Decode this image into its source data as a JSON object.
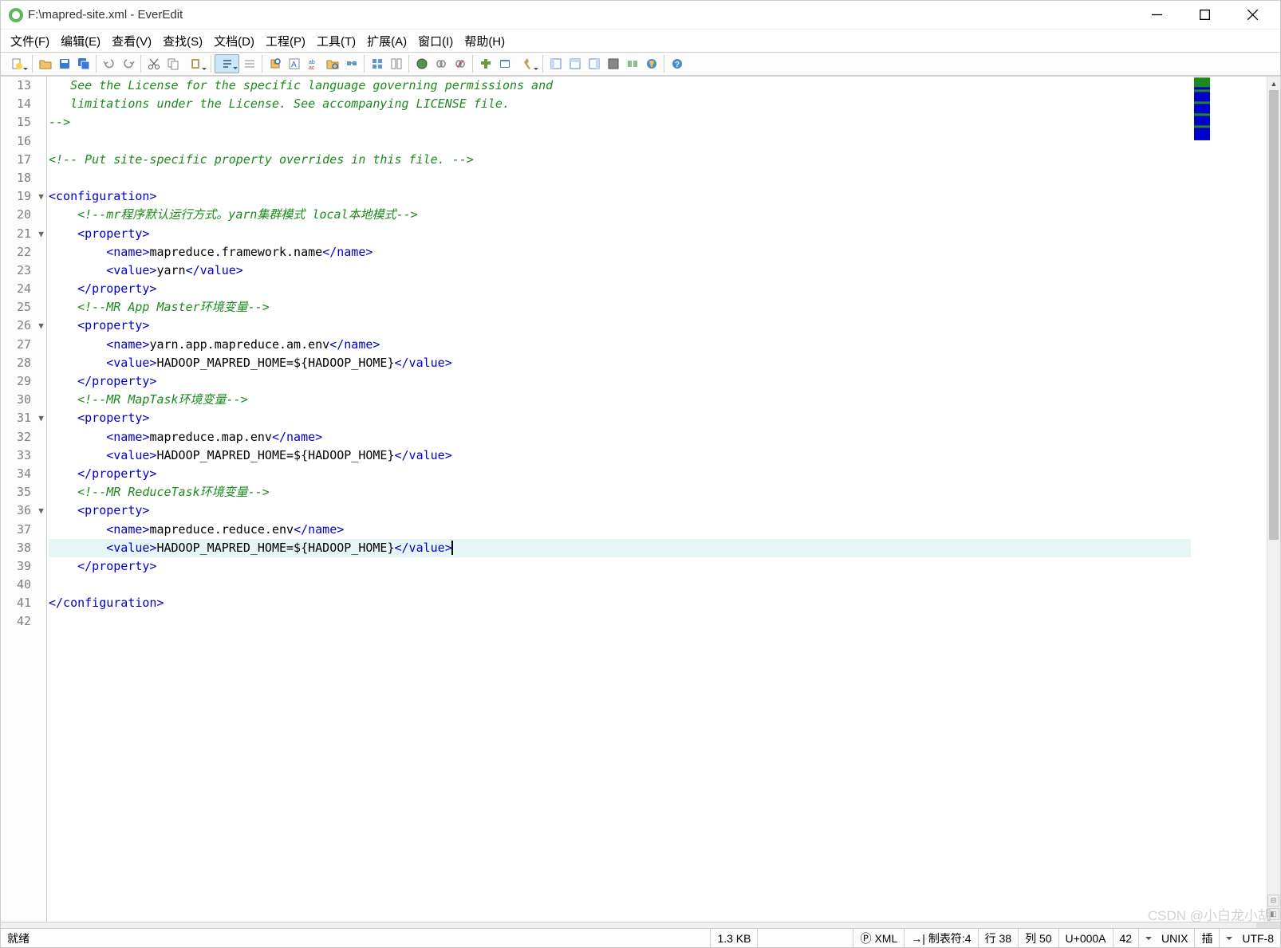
{
  "title": "F:\\mapred-site.xml - EverEdit",
  "menu": [
    "文件(F)",
    "编辑(E)",
    "查看(V)",
    "查找(S)",
    "文档(D)",
    "工程(P)",
    "工具(T)",
    "扩展(A)",
    "窗口(I)",
    "帮助(H)"
  ],
  "lines_start": 13,
  "lines_end": 42,
  "fold_markers": {
    "19": "▼",
    "21": "▼",
    "26": "▼",
    "31": "▼",
    "36": "▼"
  },
  "highlighted_line": 38,
  "code": {
    "13": [
      {
        "t": "comment",
        "v": "   See the License for the specific language governing permissions and"
      }
    ],
    "14": [
      {
        "t": "comment",
        "v": "   limitations under the License. See accompanying LICENSE file."
      }
    ],
    "15": [
      {
        "t": "comment",
        "v": "-->"
      }
    ],
    "16": [],
    "17": [
      {
        "t": "comment",
        "v": "<!-- Put site-specific property overrides in this file. -->"
      }
    ],
    "18": [],
    "19": [
      {
        "t": "tag",
        "v": "<configuration>"
      }
    ],
    "20": [
      {
        "t": "plain",
        "v": "    "
      },
      {
        "t": "comment",
        "v": "<!--mr程序默认运行方式。yarn集群模式 local本地模式-->"
      }
    ],
    "21": [
      {
        "t": "plain",
        "v": "    "
      },
      {
        "t": "tag",
        "v": "<property>"
      }
    ],
    "22": [
      {
        "t": "plain",
        "v": "        "
      },
      {
        "t": "tag",
        "v": "<name>"
      },
      {
        "t": "text",
        "v": "mapreduce.framework.name"
      },
      {
        "t": "tag",
        "v": "</name>"
      }
    ],
    "23": [
      {
        "t": "plain",
        "v": "        "
      },
      {
        "t": "tag",
        "v": "<value>"
      },
      {
        "t": "text",
        "v": "yarn"
      },
      {
        "t": "tag",
        "v": "</value>"
      }
    ],
    "24": [
      {
        "t": "plain",
        "v": "    "
      },
      {
        "t": "tag",
        "v": "</property>"
      }
    ],
    "25": [
      {
        "t": "plain",
        "v": "    "
      },
      {
        "t": "comment",
        "v": "<!--MR App Master环境变量-->"
      }
    ],
    "26": [
      {
        "t": "plain",
        "v": "    "
      },
      {
        "t": "tag",
        "v": "<property>"
      }
    ],
    "27": [
      {
        "t": "plain",
        "v": "        "
      },
      {
        "t": "tag",
        "v": "<name>"
      },
      {
        "t": "text",
        "v": "yarn.app.mapreduce.am.env"
      },
      {
        "t": "tag",
        "v": "</name>"
      }
    ],
    "28": [
      {
        "t": "plain",
        "v": "        "
      },
      {
        "t": "tag",
        "v": "<value>"
      },
      {
        "t": "text",
        "v": "HADOOP_MAPRED_HOME=${HADOOP_HOME}"
      },
      {
        "t": "tag",
        "v": "</value>"
      }
    ],
    "29": [
      {
        "t": "plain",
        "v": "    "
      },
      {
        "t": "tag",
        "v": "</property>"
      }
    ],
    "30": [
      {
        "t": "plain",
        "v": "    "
      },
      {
        "t": "comment",
        "v": "<!--MR MapTask环境变量-->"
      }
    ],
    "31": [
      {
        "t": "plain",
        "v": "    "
      },
      {
        "t": "tag",
        "v": "<property>"
      }
    ],
    "32": [
      {
        "t": "plain",
        "v": "        "
      },
      {
        "t": "tag",
        "v": "<name>"
      },
      {
        "t": "text",
        "v": "mapreduce.map.env"
      },
      {
        "t": "tag",
        "v": "</name>"
      }
    ],
    "33": [
      {
        "t": "plain",
        "v": "        "
      },
      {
        "t": "tag",
        "v": "<value>"
      },
      {
        "t": "text",
        "v": "HADOOP_MAPRED_HOME=${HADOOP_HOME}"
      },
      {
        "t": "tag",
        "v": "</value>"
      }
    ],
    "34": [
      {
        "t": "plain",
        "v": "    "
      },
      {
        "t": "tag",
        "v": "</property>"
      }
    ],
    "35": [
      {
        "t": "plain",
        "v": "    "
      },
      {
        "t": "comment",
        "v": "<!--MR ReduceTask环境变量-->"
      }
    ],
    "36": [
      {
        "t": "plain",
        "v": "    "
      },
      {
        "t": "tag",
        "v": "<property>"
      }
    ],
    "37": [
      {
        "t": "plain",
        "v": "        "
      },
      {
        "t": "tag",
        "v": "<name>"
      },
      {
        "t": "text",
        "v": "mapreduce.reduce.env"
      },
      {
        "t": "tag",
        "v": "</name>"
      }
    ],
    "38": [
      {
        "t": "plain",
        "v": "        "
      },
      {
        "t": "tag",
        "v": "<value>"
      },
      {
        "t": "text",
        "v": "HADOOP_MAPRED_HOME=${HADOOP_HOME}"
      },
      {
        "t": "tag",
        "v": "</value>"
      },
      {
        "t": "caret",
        "v": ""
      }
    ],
    "39": [
      {
        "t": "plain",
        "v": "    "
      },
      {
        "t": "tag",
        "v": "</property>"
      }
    ],
    "40": [],
    "41": [
      {
        "t": "tag",
        "v": "</configuration>"
      }
    ],
    "42": []
  },
  "status": {
    "ready": "就绪",
    "size": "1.3 KB",
    "lang_icon": "Ⓟ",
    "lang": "XML",
    "tab_icon": "→|",
    "tab": "制表符:4",
    "line": "行 38",
    "col": "列 50",
    "char": "U+000A",
    "chars": "42",
    "eol_arr": "▾",
    "eol": "UNIX",
    "mode": "插",
    "enc_arr": "▾",
    "enc": "UTF-8"
  },
  "watermark": "CSDN @小白龙小胡"
}
